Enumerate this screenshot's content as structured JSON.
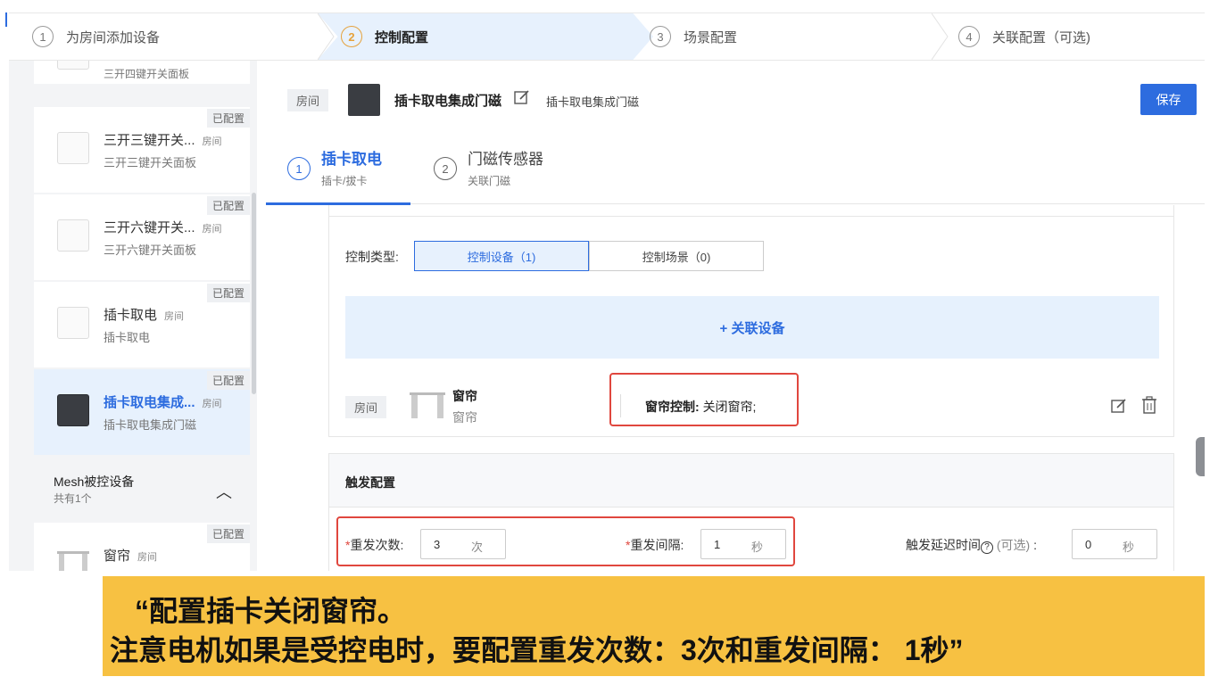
{
  "steps": [
    {
      "num": "1",
      "label": "为房间添加设备"
    },
    {
      "num": "2",
      "label": "控制配置"
    },
    {
      "num": "3",
      "label": "场景配置"
    },
    {
      "num": "4",
      "label": "关联配置（可选)"
    }
  ],
  "sidebar": {
    "top_partial": "三开四键开关面板",
    "devices": [
      {
        "tag": "已配置",
        "name": "三开三键开关...",
        "room": "房间",
        "sub": "三开三键开关面板"
      },
      {
        "tag": "已配置",
        "name": "三开六键开关...",
        "room": "房间",
        "sub": "三开六键开关面板"
      },
      {
        "tag": "已配置",
        "name": "插卡取电",
        "room": "房间",
        "sub": "插卡取电"
      },
      {
        "tag": "已配置",
        "name": "插卡取电集成...",
        "room": "房间",
        "sub": "插卡取电集成门磁"
      }
    ],
    "mesh": {
      "title": "Mesh被控设备",
      "count": "共有1个"
    },
    "mesh_device": {
      "tag": "已配置",
      "name": "窗帘",
      "room": "房间"
    }
  },
  "main": {
    "room_tag": "房间",
    "title": "插卡取电集成门磁",
    "subtitle": "插卡取电集成门磁",
    "save_label": "保存",
    "tabs": [
      {
        "num": "1",
        "title": "插卡取电",
        "sub": "插卡/拔卡"
      },
      {
        "num": "2",
        "title": "门磁传感器",
        "sub": "关联门磁"
      }
    ],
    "control_type_label": "控制类型:",
    "segments": [
      "控制设备（1)",
      "控制场景（0)"
    ],
    "link_device_label": "+ 关联设备",
    "linked_row": {
      "room": "房间",
      "name": "窗帘",
      "sub": "窗帘",
      "control_key": "窗帘控制:",
      "control_value": "关闭窗帘;"
    },
    "trigger": {
      "title": "触发配置",
      "repeat_count_label": "重发次数:",
      "repeat_count_value": "3",
      "repeat_count_unit": "次",
      "repeat_interval_label": "重发间隔:",
      "repeat_interval_value": "1",
      "repeat_interval_unit": "秒",
      "delay_label": "触发延迟时间",
      "delay_optional": "(可选)",
      "delay_colon": ":",
      "delay_value": "0",
      "delay_unit": "秒"
    }
  },
  "caption": {
    "line1": "“配置插卡关闭窗帘。",
    "line2": "注意电机如果是受控电时，要配置重发次数：3次和重发间隔： 1秒”"
  },
  "colors": {
    "accent": "#2d6cdf",
    "highlight": "#e0473e",
    "caption_bg": "#f7c142",
    "step_active": "#e6a23c"
  }
}
